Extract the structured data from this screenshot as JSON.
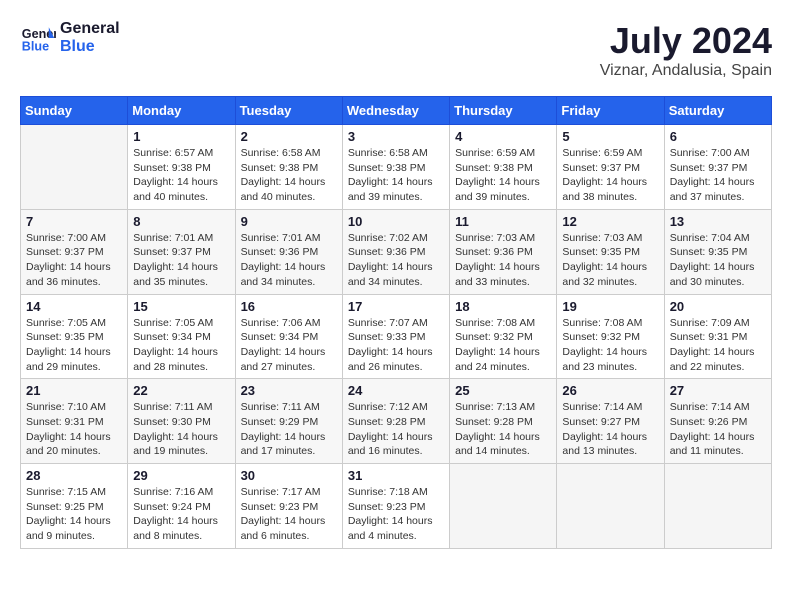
{
  "header": {
    "logo": {
      "line1": "General",
      "line2": "Blue"
    },
    "title": "July 2024",
    "subtitle": "Viznar, Andalusia, Spain"
  },
  "days_of_week": [
    "Sunday",
    "Monday",
    "Tuesday",
    "Wednesday",
    "Thursday",
    "Friday",
    "Saturday"
  ],
  "weeks": [
    [
      {
        "day": "",
        "empty": true
      },
      {
        "day": "1",
        "sunrise": "Sunrise: 6:57 AM",
        "sunset": "Sunset: 9:38 PM",
        "daylight": "Daylight: 14 hours and 40 minutes."
      },
      {
        "day": "2",
        "sunrise": "Sunrise: 6:58 AM",
        "sunset": "Sunset: 9:38 PM",
        "daylight": "Daylight: 14 hours and 40 minutes."
      },
      {
        "day": "3",
        "sunrise": "Sunrise: 6:58 AM",
        "sunset": "Sunset: 9:38 PM",
        "daylight": "Daylight: 14 hours and 39 minutes."
      },
      {
        "day": "4",
        "sunrise": "Sunrise: 6:59 AM",
        "sunset": "Sunset: 9:38 PM",
        "daylight": "Daylight: 14 hours and 39 minutes."
      },
      {
        "day": "5",
        "sunrise": "Sunrise: 6:59 AM",
        "sunset": "Sunset: 9:37 PM",
        "daylight": "Daylight: 14 hours and 38 minutes."
      },
      {
        "day": "6",
        "sunrise": "Sunrise: 7:00 AM",
        "sunset": "Sunset: 9:37 PM",
        "daylight": "Daylight: 14 hours and 37 minutes."
      }
    ],
    [
      {
        "day": "7",
        "sunrise": "Sunrise: 7:00 AM",
        "sunset": "Sunset: 9:37 PM",
        "daylight": "Daylight: 14 hours and 36 minutes."
      },
      {
        "day": "8",
        "sunrise": "Sunrise: 7:01 AM",
        "sunset": "Sunset: 9:37 PM",
        "daylight": "Daylight: 14 hours and 35 minutes."
      },
      {
        "day": "9",
        "sunrise": "Sunrise: 7:01 AM",
        "sunset": "Sunset: 9:36 PM",
        "daylight": "Daylight: 14 hours and 34 minutes."
      },
      {
        "day": "10",
        "sunrise": "Sunrise: 7:02 AM",
        "sunset": "Sunset: 9:36 PM",
        "daylight": "Daylight: 14 hours and 34 minutes."
      },
      {
        "day": "11",
        "sunrise": "Sunrise: 7:03 AM",
        "sunset": "Sunset: 9:36 PM",
        "daylight": "Daylight: 14 hours and 33 minutes."
      },
      {
        "day": "12",
        "sunrise": "Sunrise: 7:03 AM",
        "sunset": "Sunset: 9:35 PM",
        "daylight": "Daylight: 14 hours and 32 minutes."
      },
      {
        "day": "13",
        "sunrise": "Sunrise: 7:04 AM",
        "sunset": "Sunset: 9:35 PM",
        "daylight": "Daylight: 14 hours and 30 minutes."
      }
    ],
    [
      {
        "day": "14",
        "sunrise": "Sunrise: 7:05 AM",
        "sunset": "Sunset: 9:35 PM",
        "daylight": "Daylight: 14 hours and 29 minutes."
      },
      {
        "day": "15",
        "sunrise": "Sunrise: 7:05 AM",
        "sunset": "Sunset: 9:34 PM",
        "daylight": "Daylight: 14 hours and 28 minutes."
      },
      {
        "day": "16",
        "sunrise": "Sunrise: 7:06 AM",
        "sunset": "Sunset: 9:34 PM",
        "daylight": "Daylight: 14 hours and 27 minutes."
      },
      {
        "day": "17",
        "sunrise": "Sunrise: 7:07 AM",
        "sunset": "Sunset: 9:33 PM",
        "daylight": "Daylight: 14 hours and 26 minutes."
      },
      {
        "day": "18",
        "sunrise": "Sunrise: 7:08 AM",
        "sunset": "Sunset: 9:32 PM",
        "daylight": "Daylight: 14 hours and 24 minutes."
      },
      {
        "day": "19",
        "sunrise": "Sunrise: 7:08 AM",
        "sunset": "Sunset: 9:32 PM",
        "daylight": "Daylight: 14 hours and 23 minutes."
      },
      {
        "day": "20",
        "sunrise": "Sunrise: 7:09 AM",
        "sunset": "Sunset: 9:31 PM",
        "daylight": "Daylight: 14 hours and 22 minutes."
      }
    ],
    [
      {
        "day": "21",
        "sunrise": "Sunrise: 7:10 AM",
        "sunset": "Sunset: 9:31 PM",
        "daylight": "Daylight: 14 hours and 20 minutes."
      },
      {
        "day": "22",
        "sunrise": "Sunrise: 7:11 AM",
        "sunset": "Sunset: 9:30 PM",
        "daylight": "Daylight: 14 hours and 19 minutes."
      },
      {
        "day": "23",
        "sunrise": "Sunrise: 7:11 AM",
        "sunset": "Sunset: 9:29 PM",
        "daylight": "Daylight: 14 hours and 17 minutes."
      },
      {
        "day": "24",
        "sunrise": "Sunrise: 7:12 AM",
        "sunset": "Sunset: 9:28 PM",
        "daylight": "Daylight: 14 hours and 16 minutes."
      },
      {
        "day": "25",
        "sunrise": "Sunrise: 7:13 AM",
        "sunset": "Sunset: 9:28 PM",
        "daylight": "Daylight: 14 hours and 14 minutes."
      },
      {
        "day": "26",
        "sunrise": "Sunrise: 7:14 AM",
        "sunset": "Sunset: 9:27 PM",
        "daylight": "Daylight: 14 hours and 13 minutes."
      },
      {
        "day": "27",
        "sunrise": "Sunrise: 7:14 AM",
        "sunset": "Sunset: 9:26 PM",
        "daylight": "Daylight: 14 hours and 11 minutes."
      }
    ],
    [
      {
        "day": "28",
        "sunrise": "Sunrise: 7:15 AM",
        "sunset": "Sunset: 9:25 PM",
        "daylight": "Daylight: 14 hours and 9 minutes."
      },
      {
        "day": "29",
        "sunrise": "Sunrise: 7:16 AM",
        "sunset": "Sunset: 9:24 PM",
        "daylight": "Daylight: 14 hours and 8 minutes."
      },
      {
        "day": "30",
        "sunrise": "Sunrise: 7:17 AM",
        "sunset": "Sunset: 9:23 PM",
        "daylight": "Daylight: 14 hours and 6 minutes."
      },
      {
        "day": "31",
        "sunrise": "Sunrise: 7:18 AM",
        "sunset": "Sunset: 9:23 PM",
        "daylight": "Daylight: 14 hours and 4 minutes."
      },
      {
        "day": "",
        "empty": true
      },
      {
        "day": "",
        "empty": true
      },
      {
        "day": "",
        "empty": true
      }
    ]
  ]
}
